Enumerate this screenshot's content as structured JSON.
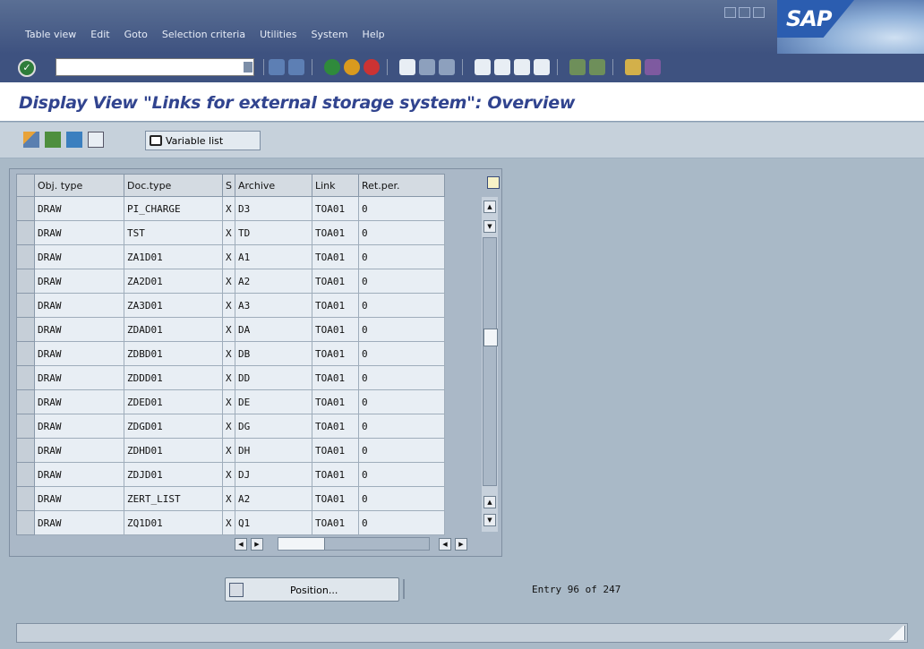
{
  "menu": [
    "Table view",
    "Edit",
    "Goto",
    "Selection criteria",
    "Utilities",
    "System",
    "Help"
  ],
  "logo": "SAP",
  "command_field": {
    "value": ""
  },
  "page_title": "Display View \"Links for external storage system\": Overview",
  "app_toolbar": {
    "variable_list_label": "Variable list"
  },
  "table": {
    "headers": [
      "Obj. type",
      "Doc.type",
      "S",
      "Archive",
      "Link",
      "Ret.per."
    ],
    "rows": [
      [
        "DRAW",
        "PI_CHARGE",
        "X",
        "D3",
        "TOA01",
        "0"
      ],
      [
        "DRAW",
        "TST",
        "X",
        "TD",
        "TOA01",
        "0"
      ],
      [
        "DRAW",
        "ZA1D01",
        "X",
        "A1",
        "TOA01",
        "0"
      ],
      [
        "DRAW",
        "ZA2D01",
        "X",
        "A2",
        "TOA01",
        "0"
      ],
      [
        "DRAW",
        "ZA3D01",
        "X",
        "A3",
        "TOA01",
        "0"
      ],
      [
        "DRAW",
        "ZDAD01",
        "X",
        "DA",
        "TOA01",
        "0"
      ],
      [
        "DRAW",
        "ZDBD01",
        "X",
        "DB",
        "TOA01",
        "0"
      ],
      [
        "DRAW",
        "ZDDD01",
        "X",
        "DD",
        "TOA01",
        "0"
      ],
      [
        "DRAW",
        "ZDED01",
        "X",
        "DE",
        "TOA01",
        "0"
      ],
      [
        "DRAW",
        "ZDGD01",
        "X",
        "DG",
        "TOA01",
        "0"
      ],
      [
        "DRAW",
        "ZDHD01",
        "X",
        "DH",
        "TOA01",
        "0"
      ],
      [
        "DRAW",
        "ZDJD01",
        "X",
        "DJ",
        "TOA01",
        "0"
      ],
      [
        "DRAW",
        "ZERT_LIST",
        "X",
        "A2",
        "TOA01",
        "0"
      ],
      [
        "DRAW",
        "ZQ1D01",
        "X",
        "Q1",
        "TOA01",
        "0"
      ]
    ]
  },
  "position_button": {
    "label": "Position..."
  },
  "entry_info": "Entry 96 of 247",
  "colors": {
    "title_text": "#31448f",
    "frame_bg": "#a9b9c7",
    "header_bar": "#3e5280"
  }
}
